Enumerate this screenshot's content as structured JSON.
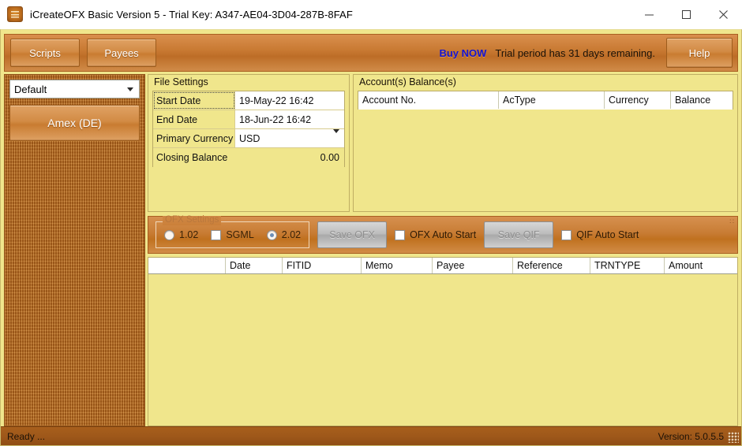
{
  "window": {
    "title": "iCreateOFX Basic Version 5 - Trial Key: A347-AE04-3D04-287B-8FAF",
    "app_icon": "app-icon",
    "minimize_label": "—",
    "maximize_label": "☐",
    "close_label": "✕"
  },
  "toolbar": {
    "scripts_label": "Scripts",
    "payees_label": "Payees",
    "buy_now_label": "Buy NOW",
    "trial_text": "Trial period has 31 days remaining.",
    "help_label": "Help",
    "buy_now_color": "#1414d2",
    "accent_color": "#c97a33"
  },
  "sidebar": {
    "profile_select_value": "Default",
    "account_button_label": "Amex (DE)"
  },
  "file_settings": {
    "title": "File Settings",
    "rows": [
      {
        "label": "Start Date",
        "value": "19-May-22 16:42"
      },
      {
        "label": "End Date",
        "value": "18-Jun-22 16:42"
      },
      {
        "label": "Primary Currency",
        "value": "USD"
      },
      {
        "label": "Closing Balance",
        "value": "0.00"
      }
    ]
  },
  "account_balances": {
    "title": "Account(s) Balance(s)",
    "columns": [
      "Account No.",
      "AcType",
      "Currency",
      "Balance"
    ],
    "rows": []
  },
  "ofx_settings": {
    "group_title": "OFX Settings",
    "version_1_label": "1.02",
    "sgml_label": "SGML",
    "version_2_label": "2.02",
    "version_1_selected": false,
    "version_2_selected": true,
    "sgml_checked": false,
    "save_ofx_label": "Save OFX",
    "ofx_auto_start_label": "OFX Auto Start",
    "ofx_auto_start_checked": false,
    "save_qif_label": "Save QIF",
    "qif_auto_start_label": "QIF Auto Start",
    "qif_auto_start_checked": false,
    "corner_mark": "∷"
  },
  "transactions": {
    "columns": [
      "",
      "Date",
      "FITID",
      "Memo",
      "Payee",
      "Reference",
      "TRNTYPE",
      "Amount"
    ],
    "rows": []
  },
  "statusbar": {
    "status_text": "Ready ...",
    "version_text": "Version: 5.0.5.5"
  }
}
